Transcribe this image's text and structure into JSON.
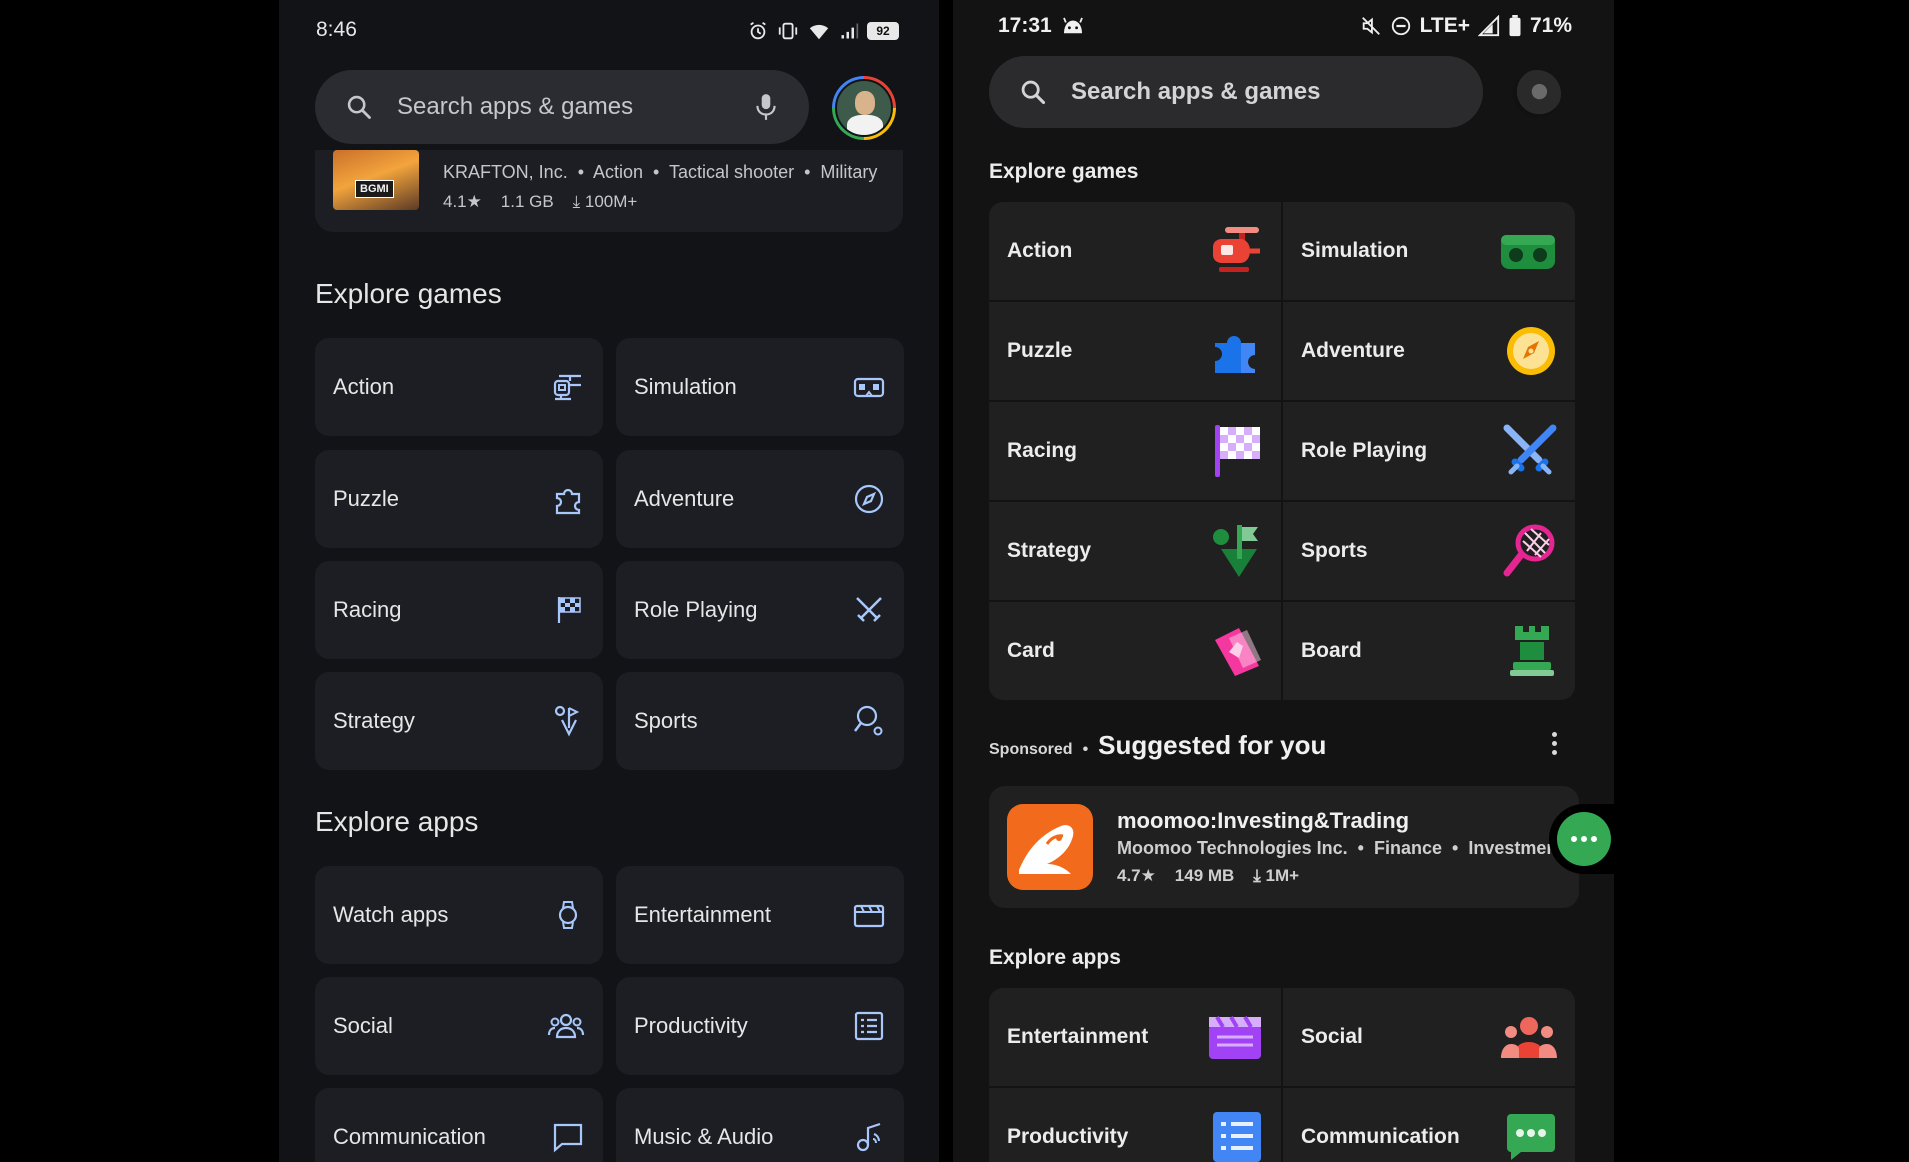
{
  "left": {
    "status": {
      "time": "8:46",
      "battery": "92"
    },
    "search": {
      "placeholder": "Search apps & games"
    },
    "featured_app": {
      "thumb_badge": "BGMI",
      "developer": "KRAFTON, Inc.",
      "tags": [
        "Action",
        "Tactical shooter",
        "Military"
      ],
      "rating": "4.1",
      "size": "1.1 GB",
      "downloads": "100M+"
    },
    "explore_games": {
      "title": "Explore games",
      "items": [
        "Action",
        "Simulation",
        "Puzzle",
        "Adventure",
        "Racing",
        "Role Playing",
        "Strategy",
        "Sports"
      ]
    },
    "explore_apps": {
      "title": "Explore apps",
      "items": [
        "Watch apps",
        "Entertainment",
        "Social",
        "Productivity",
        "Communication",
        "Music & Audio"
      ]
    }
  },
  "right": {
    "status": {
      "time": "17:31",
      "network": "LTE+",
      "battery": "71%"
    },
    "search": {
      "placeholder": "Search apps & games"
    },
    "explore_games": {
      "title": "Explore games",
      "items": [
        "Action",
        "Simulation",
        "Puzzle",
        "Adventure",
        "Racing",
        "Role Playing",
        "Strategy",
        "Sports",
        "Card",
        "Board"
      ]
    },
    "suggested": {
      "sponsored_label": "Sponsored",
      "title": "Suggested for you",
      "app": {
        "name": "moomoo:Investing&Trading",
        "developer": "Moomoo Technologies Inc.",
        "tags": [
          "Finance",
          "Investment"
        ],
        "rating": "4.7",
        "size": "149 MB",
        "downloads": "1M+"
      }
    },
    "explore_apps": {
      "title": "Explore apps",
      "items": [
        "Entertainment",
        "Social",
        "Productivity",
        "Communication"
      ]
    }
  },
  "colors": {
    "left_bg": "#111317",
    "left_tile": "#1c1e23",
    "left_icon": "#a8c7fa",
    "right_bg": "#131313",
    "right_tile": "#202020",
    "fab_green": "#34a853",
    "moomoo_orange": "#f26a1b"
  }
}
